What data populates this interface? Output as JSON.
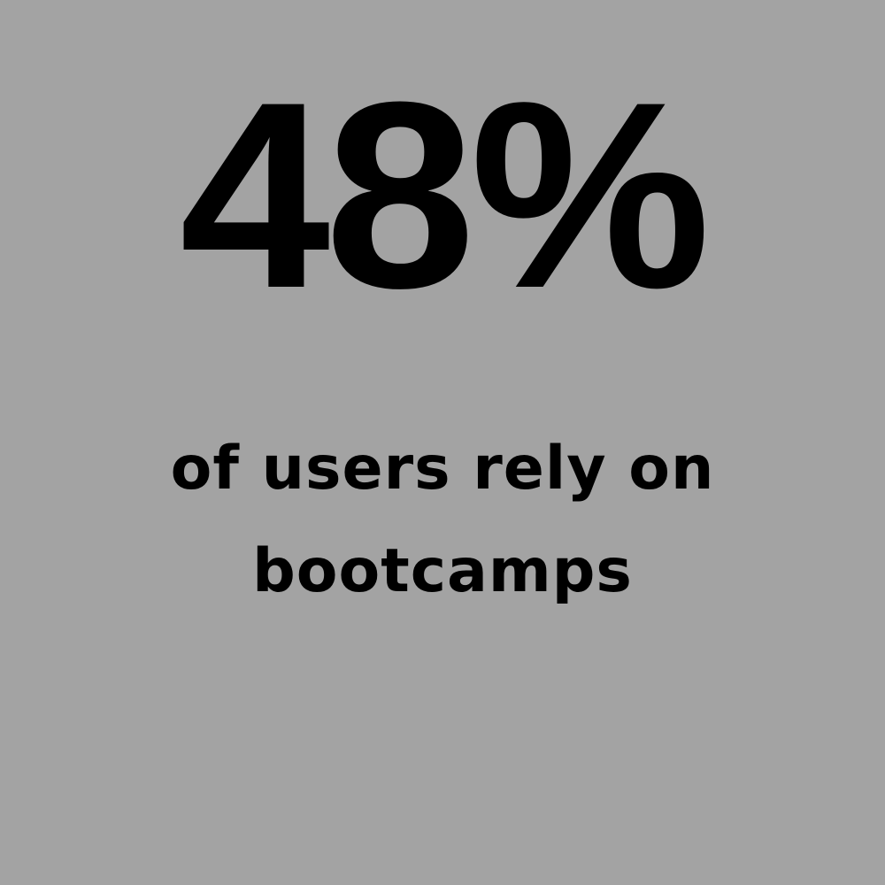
{
  "stat": {
    "value": "48%",
    "caption_lines": [
      "of users rely on",
      "bootcamps"
    ]
  },
  "colors": {
    "background": "#a3a3a3",
    "text": "#000000"
  }
}
